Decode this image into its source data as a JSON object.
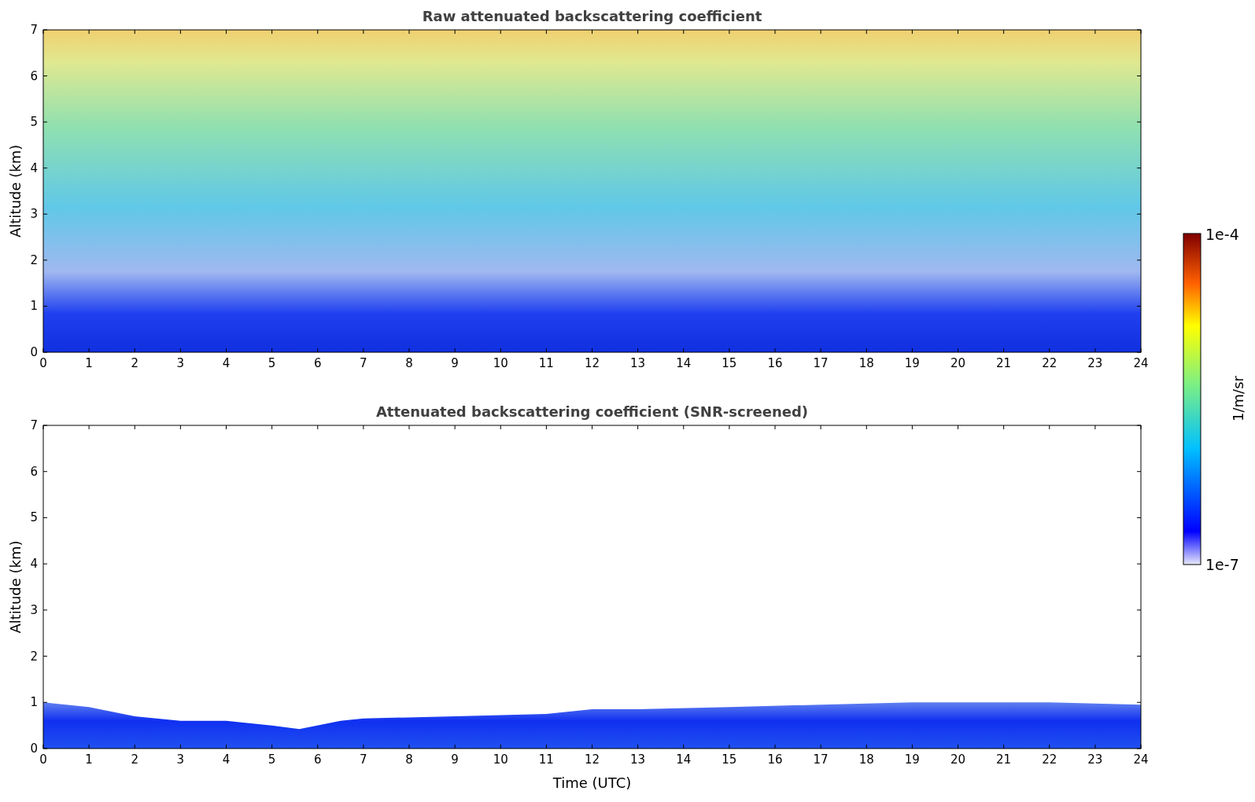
{
  "panels": [
    {
      "kind": "raw",
      "title": "Raw attenuated backscattering coefficient",
      "ylabel": "Altitude (km)",
      "yticks": [
        "7",
        "6",
        "5",
        "4",
        "3",
        "2",
        "1",
        "0"
      ],
      "xticks": [
        "0",
        "1",
        "2",
        "3",
        "4",
        "5",
        "6",
        "7",
        "8",
        "9",
        "10",
        "11",
        "12",
        "13",
        "14",
        "15",
        "16",
        "17",
        "18",
        "19",
        "20",
        "21",
        "22",
        "23",
        "24"
      ]
    },
    {
      "kind": "screened",
      "title": "Attenuated backscattering coefficient (SNR-screened)",
      "ylabel": "Altitude (km)",
      "yticks": [
        "7",
        "6",
        "5",
        "4",
        "3",
        "2",
        "1",
        "0"
      ],
      "xticks": [
        "0",
        "1",
        "2",
        "3",
        "4",
        "5",
        "6",
        "7",
        "8",
        "9",
        "10",
        "11",
        "12",
        "13",
        "14",
        "15",
        "16",
        "17",
        "18",
        "19",
        "20",
        "21",
        "22",
        "23",
        "24"
      ],
      "xlabel": "Time (UTC)"
    }
  ],
  "colorbar": {
    "max_label": "1e-4",
    "min_label": "1e-7",
    "unit": "1/m/sr"
  }
}
